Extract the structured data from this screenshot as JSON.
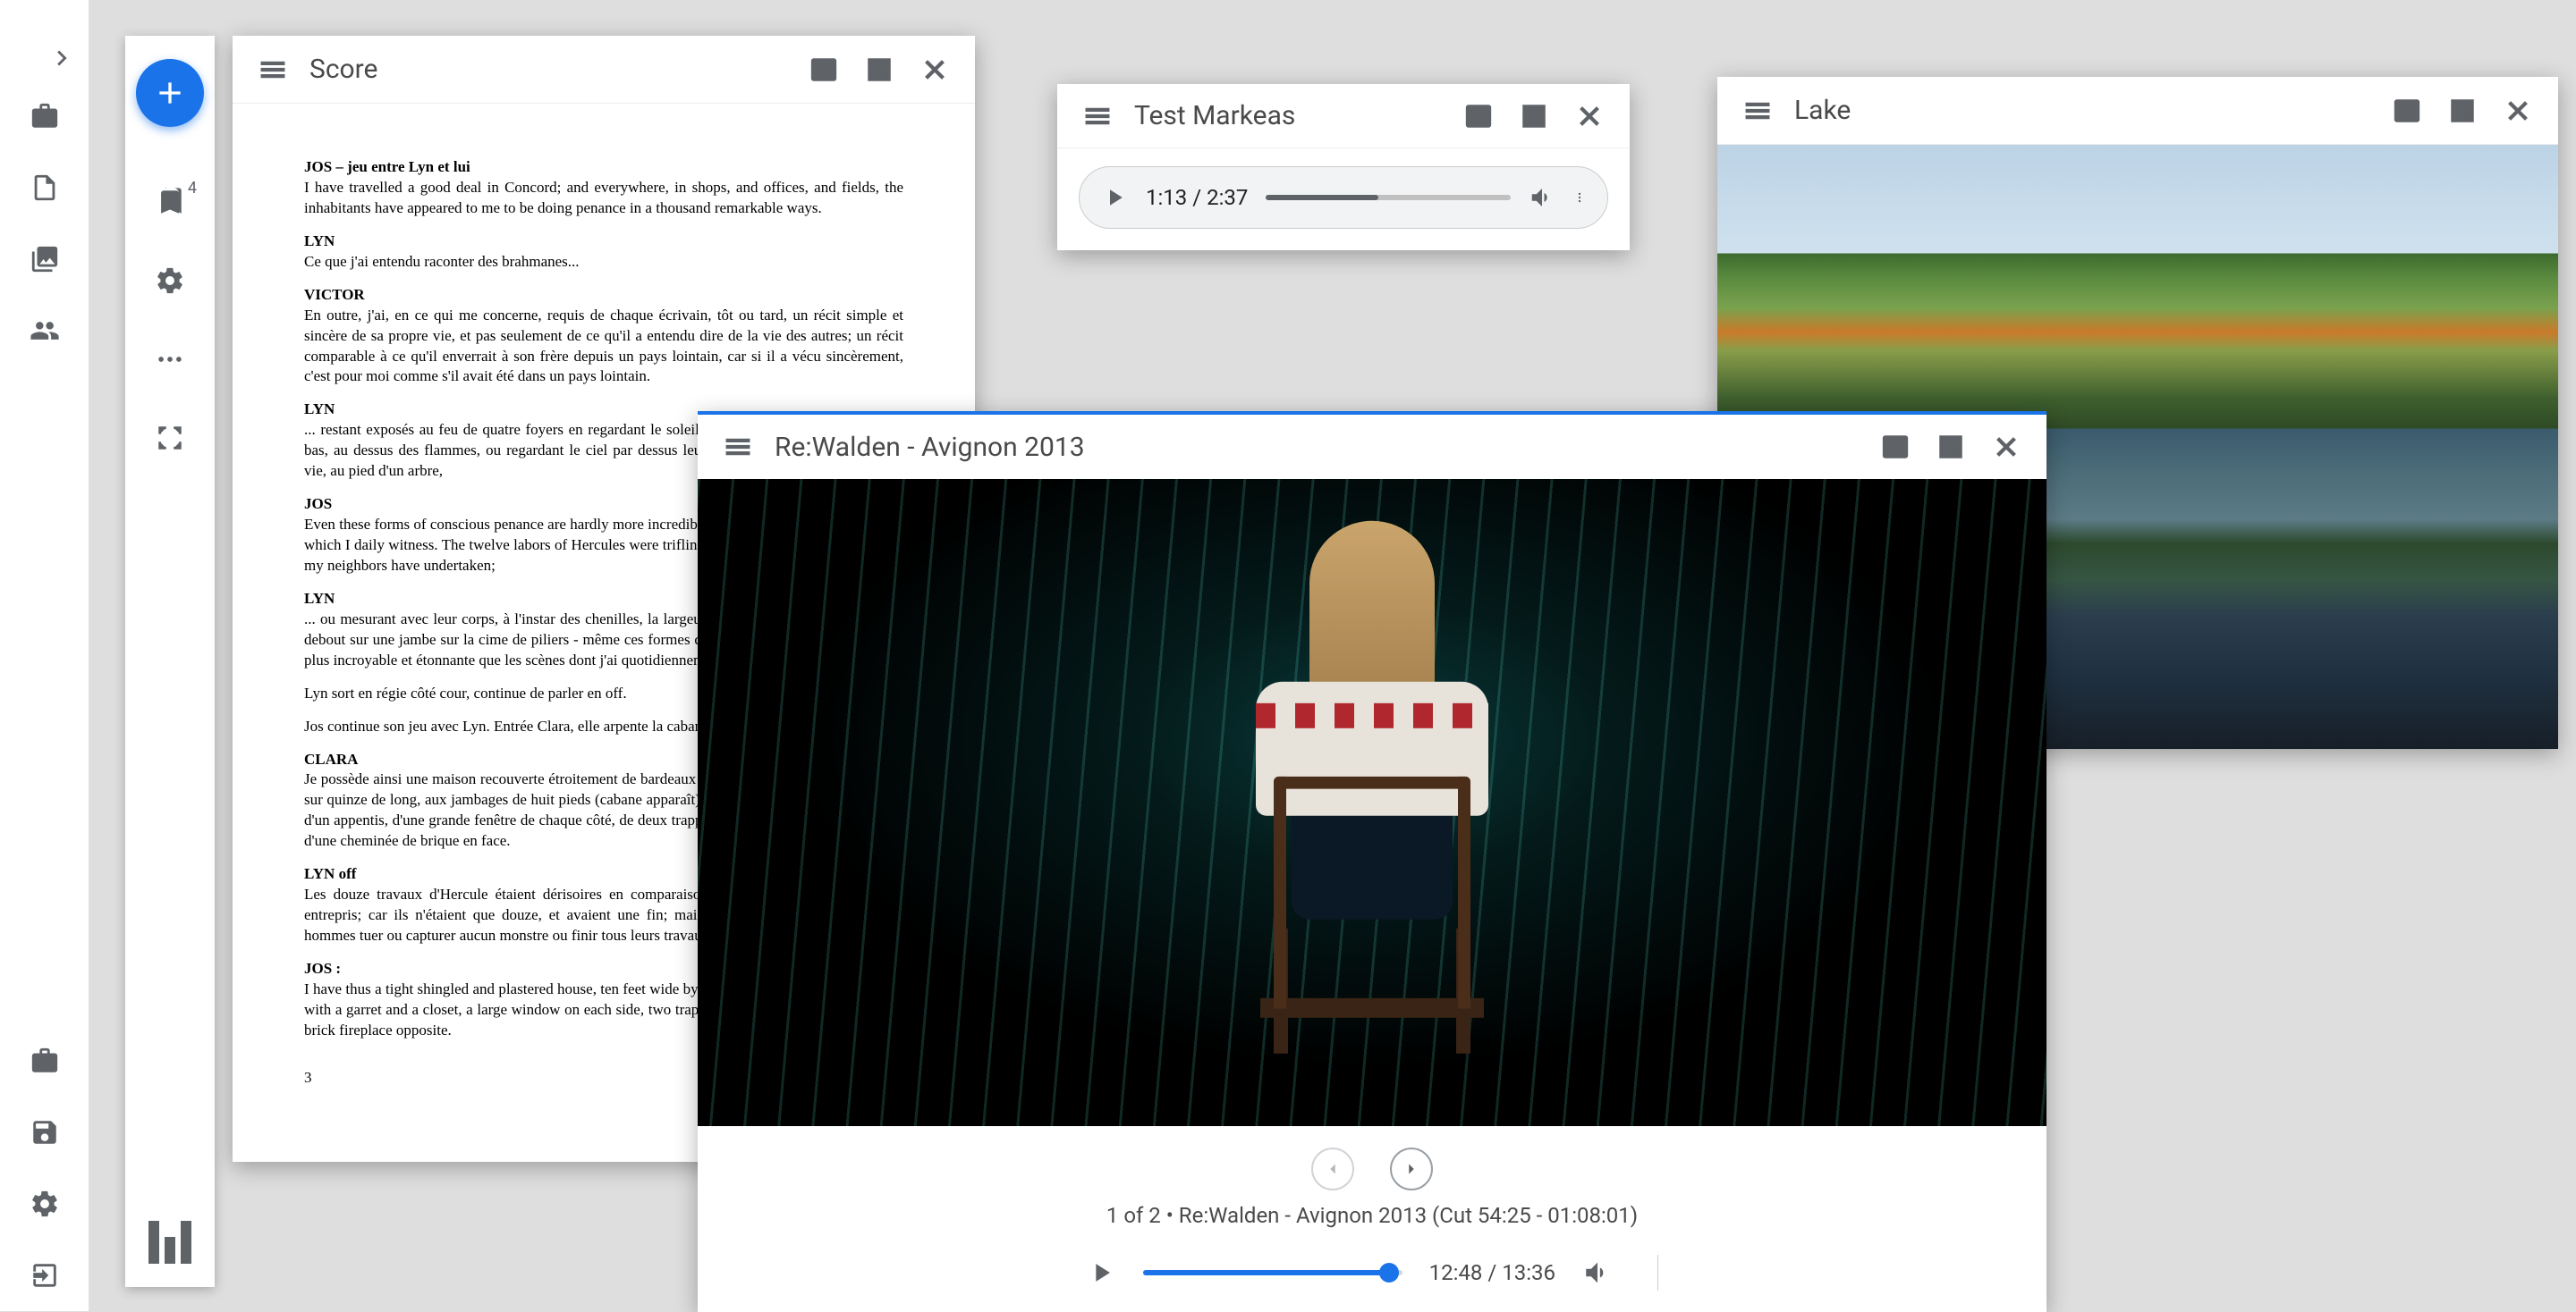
{
  "rail": {
    "bookmark_badge": "4"
  },
  "panels": {
    "score": {
      "title": "Score",
      "page_number": "3",
      "blocks": [
        {
          "speaker": "JOS – jeu entre Lyn et lui",
          "text": "I have travelled a good deal in Concord; and everywhere, in shops, and offices, and fields, the inhabitants have appeared to me to be doing penance in a thousand remarkable ways."
        },
        {
          "speaker": "LYN",
          "text": "Ce que j'ai entendu raconter des brahmanes..."
        },
        {
          "speaker": "VICTOR",
          "text": "En outre, j'ai, en ce qui me concerne, requis de chaque écrivain, tôt ou tard, un récit simple et sincère de sa propre vie, et pas seulement de ce qu'il a entendu dire de la vie des autres; un récit comparable à ce qu'il enverrait à son frère depuis un pays lointain, car si il a vécu sincèrement, c'est pour moi comme s'il avait été dans un pays lointain."
        },
        {
          "speaker": "LYN",
          "text": "... restant exposés au feu de quatre foyers en regardant le soleil en face; ou suspendus la tête en bas, au dessus des flammes, ou regardant le ciel par dessus leurs épaules; ou enchaînés pour la vie, au pied d'un arbre,"
        },
        {
          "speaker": "JOS",
          "text": "Even these forms of conscious penance are hardly more incredible and astonishing than the scenes which I daily witness. The twelve labors of Hercules were trifling in comparison with those which my neighbors have undertaken;"
        },
        {
          "speaker": "LYN",
          "text": "... ou mesurant avec leur corps, à l'instar des chenilles, la largeur de vastes empires; ou se tenant debout sur une jambe sur la cime de piliers - même ces formes de pénitence voulue ne sont guère plus incroyable et étonnante que les scènes dont j'ai quotidiennement été témoin."
        },
        {
          "speaker": "",
          "text": "Lyn sort en régie côté cour, continue de parler en off."
        },
        {
          "speaker": "",
          "text": "Jos continue son jeu avec Lyn.\nEntrée Clara, elle arpente la cabane qui n'est pas encore apparue."
        },
        {
          "speaker": "CLARA",
          "text": "Je possède ainsi une maison recouverte étroitement de bardeaux et de plâtre, de dix pieds de large sur quinze de long, aux jambages de huit pieds (cabane apparaît), dotée d'un grenier, d'un placard, d'un appentis, d'une grande fenêtre de chaque côté, de deux trappes, d'une porte à son extrémité et d'une cheminée de brique en face."
        },
        {
          "speaker": "LYN off",
          "text": "Les douze travaux d'Hercule étaient dérisoires en comparaison de ceux que mes voisins ont entrepris; car ils n'étaient que douze, et avaient une fin; mais je ne pourrais jamais voir ces hommes tuer ou capturer aucun monstre ou finir tous leurs travaux."
        },
        {
          "speaker": "JOS :",
          "text": "I have thus a tight shingled and plastered house, ten feet wide by fifteen long, and eight-feet posts, with a garret and a closet, a large window on each side, two trap doors, one door at the end, and a brick fireplace opposite."
        }
      ]
    },
    "audio": {
      "title": "Test Markeas",
      "current": "1:13",
      "total": "2:37"
    },
    "lake": {
      "title": "Lake"
    },
    "video": {
      "title": "Re:Walden - Avignon 2013",
      "meta_prefix": "1 of 2 • ",
      "meta_main": "Re:Walden - Avignon 2013 (Cut 54:25 - 01:08:01)",
      "current": "12:48",
      "total": "13:36"
    }
  }
}
